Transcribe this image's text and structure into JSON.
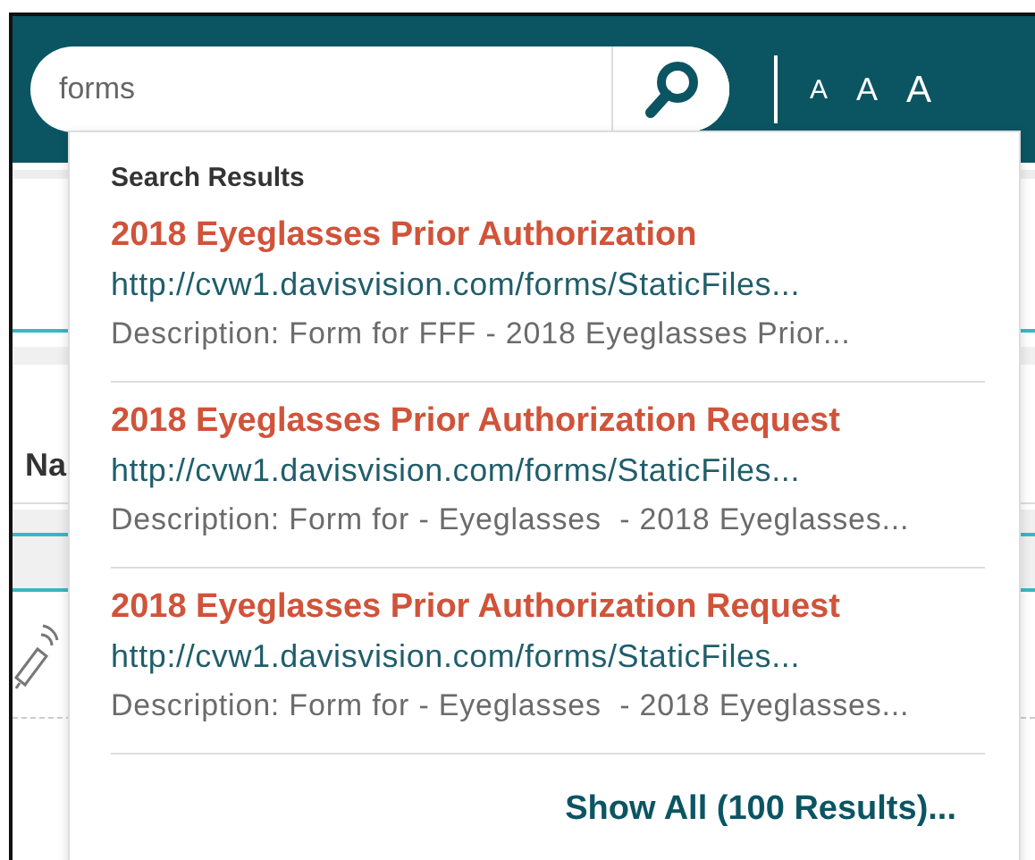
{
  "search": {
    "value": "forms"
  },
  "font_size_options": [
    "A",
    "A",
    "A"
  ],
  "page": {
    "heading": "Na"
  },
  "results_panel": {
    "title": "Search Results",
    "results": [
      {
        "title": "2018 Eyeglasses Prior Authorization",
        "url": "http://cvw1.davisvision.com/forms/StaticFiles...",
        "description": "Description: Form for FFF - 2018 Eyeglasses Prior..."
      },
      {
        "title": "2018 Eyeglasses Prior Authorization Request",
        "url": "http://cvw1.davisvision.com/forms/StaticFiles...",
        "description": "Description: Form for - Eyeglasses  - 2018 Eyeglasses..."
      },
      {
        "title": "2018 Eyeglasses Prior Authorization Request",
        "url": "http://cvw1.davisvision.com/forms/StaticFiles...",
        "description": "Description: Form for - Eyeglasses  - 2018 Eyeglasses..."
      }
    ],
    "show_all": "Show All (100 Results)..."
  }
}
